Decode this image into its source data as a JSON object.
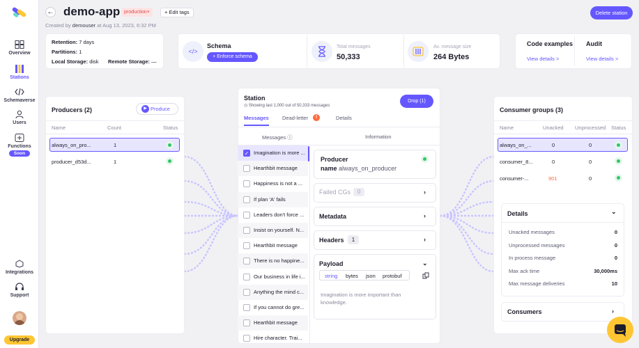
{
  "sidebar": {
    "items": [
      {
        "label": "Overview",
        "icon": "overview-icon"
      },
      {
        "label": "Stations",
        "icon": "stations-icon"
      },
      {
        "label": "Schemaverse",
        "icon": "code-icon"
      },
      {
        "label": "Users",
        "icon": "users-icon"
      },
      {
        "label": "Functions",
        "icon": "functions-icon",
        "badge": "Soon"
      },
      {
        "label": "Integrations",
        "icon": "integrations-icon"
      },
      {
        "label": "Support",
        "icon": "support-icon"
      }
    ],
    "upgrade_label": "Upgrade"
  },
  "header": {
    "title": "demo-app",
    "tag": "production",
    "tag_close": "×",
    "edit_tags": "Edit tags",
    "created_prefix": "Created by",
    "created_user": "demouser",
    "created_at": "at Aug 13, 2023, 6:32 PM",
    "delete_label": "Delete station"
  },
  "station_info": {
    "retention_label": "Retention:",
    "retention_value": "7 days",
    "partitions_label": "Partitions:",
    "partitions_value": "1",
    "local_label": "Local Storage:",
    "local_value": "disk",
    "remote_label": "Remote Storage:",
    "remote_value": "—"
  },
  "schema": {
    "title": "Schema",
    "enforce_label": "Enforce schema"
  },
  "stats": {
    "total_label": "Total messages",
    "total_value": "50,333",
    "size_label": "Av. message size",
    "size_value": "264 Bytes"
  },
  "code_examples": {
    "title": "Code examples",
    "link": "View details >"
  },
  "audit": {
    "title": "Audit",
    "link": "View details >"
  },
  "producers": {
    "title": "Producers (2)",
    "produce_label": "Produce",
    "columns": [
      "Name",
      "Count",
      "Status"
    ],
    "rows": [
      {
        "name": "always_on_pro...",
        "count": "1"
      },
      {
        "name": "producer_d53d...",
        "count": "1"
      }
    ]
  },
  "station": {
    "title": "Station",
    "subtitle": "Showing last 1,000 out of 50,333 messages",
    "drop_label": "Drop (1)",
    "tabs": [
      "Messages",
      "Dead-letter",
      "Details"
    ],
    "dead_letter_badge": "!",
    "col_messages": "Messages",
    "col_information": "Information",
    "messages": [
      "Imagination is more ...",
      "Hearthbit message",
      "Happiness is not a ...",
      "If plan 'A' fails",
      "Leaders don't force ...",
      "Insist on yourself. N...",
      "Hearthbit message",
      "There is no happine...",
      "Our business in life i...",
      "Anything the mind c...",
      "If you cannot do gre...",
      "Hearthbit message",
      "Hire character. Trai..."
    ]
  },
  "information": {
    "producer_title": "Producer",
    "name_label": "name",
    "name_value": "always_on_producer",
    "failed_cgs_label": "Failed CGs",
    "failed_cgs_count": "0",
    "metadata_label": "Metadata",
    "headers_label": "Headers",
    "headers_count": "1",
    "payload_label": "Payload",
    "payload_formats": [
      "string",
      "bytes",
      "json",
      "protobuf"
    ],
    "payload_text": "Imagination is more important than knowledge."
  },
  "consumer_groups": {
    "title": "Consumer groups (3)",
    "columns": [
      "Name",
      "Unacked",
      "Unprocessed",
      "Status"
    ],
    "rows": [
      {
        "name": "always_on_...",
        "unacked": "0",
        "unprocessed": "0"
      },
      {
        "name": "consumer_8...",
        "unacked": "0",
        "unprocessed": "0"
      },
      {
        "name": "consumer-...",
        "unacked": "901",
        "unprocessed": "0"
      }
    ]
  },
  "details": {
    "title": "Details",
    "rows": [
      {
        "label": "Unacked messages",
        "value": "0"
      },
      {
        "label": "Unprocessed messages",
        "value": "0"
      },
      {
        "label": "In process message",
        "value": "0"
      },
      {
        "label": "Max ack time",
        "value": "30,000ms"
      },
      {
        "label": "Max message deliveries",
        "value": "10"
      }
    ]
  },
  "consumers": {
    "title": "Consumers"
  },
  "colors": {
    "accent": "#6557ff",
    "ok": "#33c46b",
    "warn": "#ff6b3d",
    "upgrade": "#ffc633"
  }
}
